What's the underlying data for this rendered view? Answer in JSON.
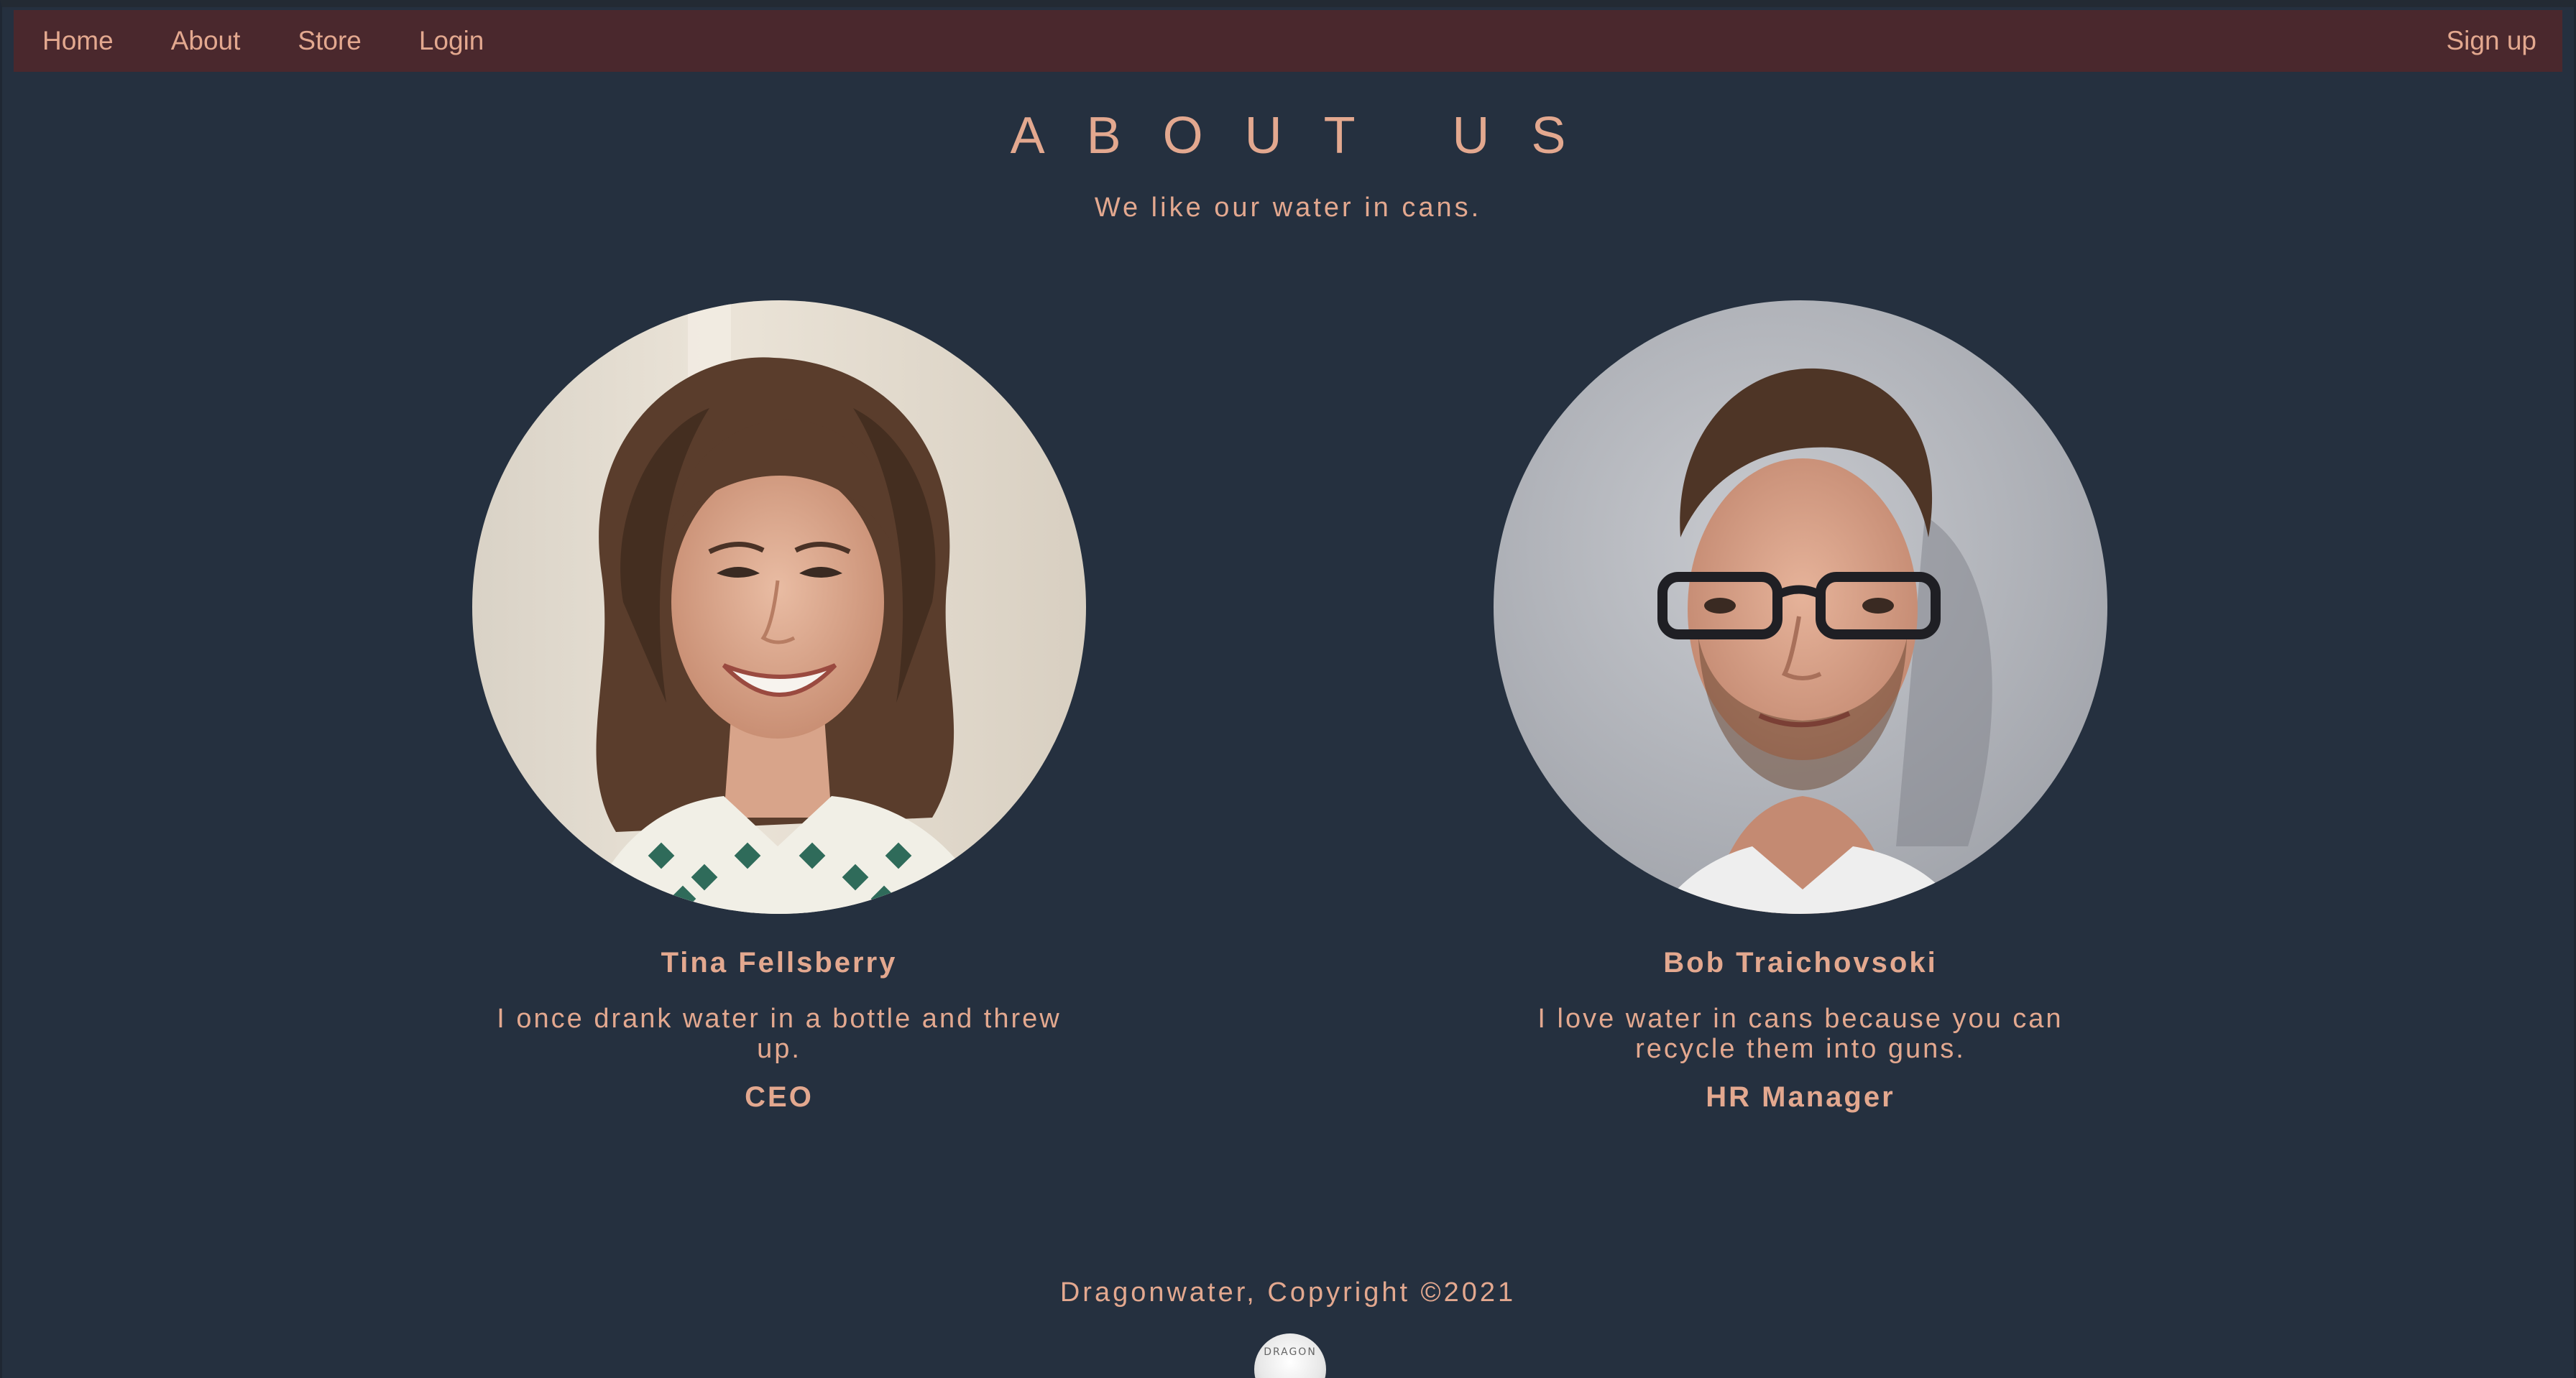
{
  "nav": {
    "home": "Home",
    "about": "About",
    "store": "Store",
    "login": "Login",
    "signup": "Sign up"
  },
  "hero": {
    "title": "ABOUT US",
    "subtitle": "We like our water in cans."
  },
  "team": [
    {
      "name": "Tina Fellsberry",
      "quote": "I once drank water in a bottle and threw up.",
      "role": "CEO",
      "photo": "woman-portrait-photo"
    },
    {
      "name": "Bob Traichovsoki",
      "quote": "I love water in cans because you can recycle them into guns.",
      "role": "HR Manager",
      "photo": "man-portrait-photo"
    }
  ],
  "footer": {
    "copyright": "Dragonwater, Copyright ©2021",
    "logo_text": "DRAGON"
  },
  "colors": {
    "background": "#25303f",
    "navbar": "#4a282d",
    "accent_text": "#e3a88f"
  }
}
